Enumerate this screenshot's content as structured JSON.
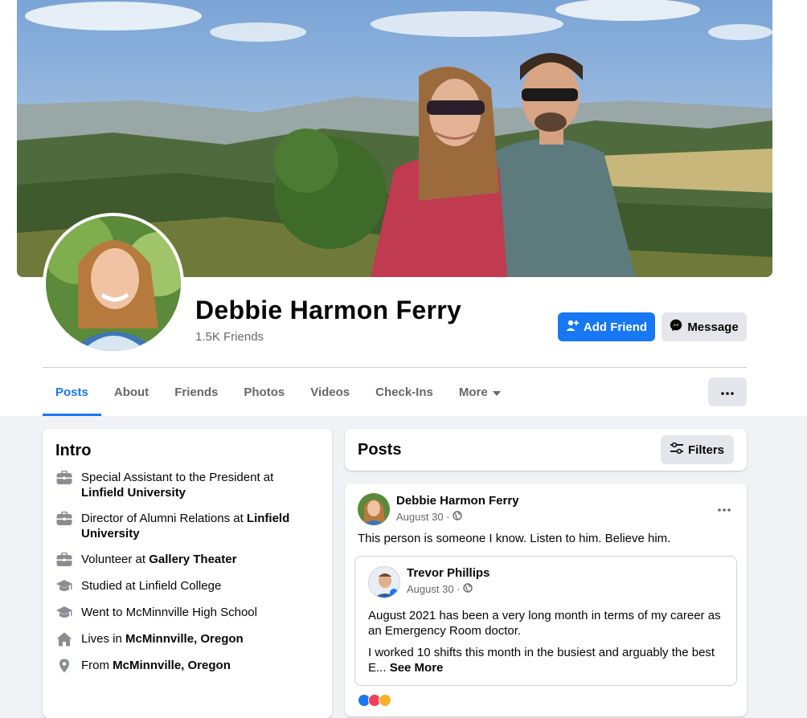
{
  "profile": {
    "name": "Debbie Harmon Ferry",
    "friends": "1.5K Friends",
    "add_friend_label": "Add Friend",
    "message_label": "Message"
  },
  "tabs": [
    {
      "label": "Posts",
      "active": true
    },
    {
      "label": "About"
    },
    {
      "label": "Friends"
    },
    {
      "label": "Photos"
    },
    {
      "label": "Videos"
    },
    {
      "label": "Check-Ins"
    },
    {
      "label": "More"
    }
  ],
  "intro": {
    "title": "Intro",
    "items": [
      {
        "icon": "briefcase-icon",
        "prefix": "Special Assistant to the President at ",
        "bold": "Linfield University"
      },
      {
        "icon": "briefcase-icon",
        "prefix": "Director of Alumni Relations at ",
        "bold": "Linfield University"
      },
      {
        "icon": "briefcase-icon",
        "prefix": "Volunteer at ",
        "bold": "Gallery Theater"
      },
      {
        "icon": "graduation-cap-icon",
        "prefix": "Studied at Linfield College",
        "bold": ""
      },
      {
        "icon": "graduation-cap-icon",
        "prefix": "Went to McMinnville High School",
        "bold": ""
      },
      {
        "icon": "house-icon",
        "prefix": "Lives in ",
        "bold": "McMinnville, Oregon"
      },
      {
        "icon": "location-pin-icon",
        "prefix": "From ",
        "bold": "McMinnville, Oregon"
      }
    ]
  },
  "posts": {
    "title": "Posts",
    "filters_label": "Filters"
  },
  "post": {
    "author": "Debbie Harmon Ferry",
    "date": "August 30 ·",
    "text": "This person is someone I know. Listen to him. Believe him.",
    "shared": {
      "author": "Trevor Phillips",
      "date": "August 30 ·",
      "text1": "August 2021 has been a very long month in terms of my career as an Emergency Room doctor.",
      "text2": "I worked 10 shifts this month in the busiest and arguably the best E...",
      "see_more": "See More"
    }
  },
  "colors": {
    "accent": "#1877f2",
    "secondary_button": "#e4e6eb",
    "page_bg": "#f0f2f5",
    "muted_text": "#65676b"
  }
}
